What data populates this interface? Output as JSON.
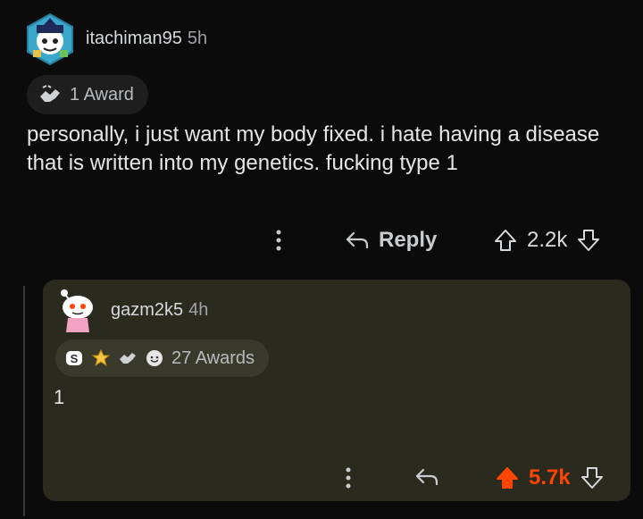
{
  "comment": {
    "username": "itachiman95",
    "time": "5h",
    "awards": "1 Award",
    "body": "personally, i just want my body fixed. i hate having a disease that is written into my genetics. fucking type 1",
    "reply_label": "Reply",
    "score": "2.2k"
  },
  "reply": {
    "username": "gazm2k5",
    "time": "4h",
    "awards": "27 Awards",
    "body": "1",
    "score": "5.7k"
  },
  "colors": {
    "upvote_active": "#ff4500",
    "reply_card_bg": "#2a2a1e"
  },
  "icons": {
    "menu": "kebab-dots-icon",
    "reply": "reply-arrow-icon",
    "upvote": "upvote-arrow-icon",
    "downvote": "downvote-arrow-icon"
  }
}
